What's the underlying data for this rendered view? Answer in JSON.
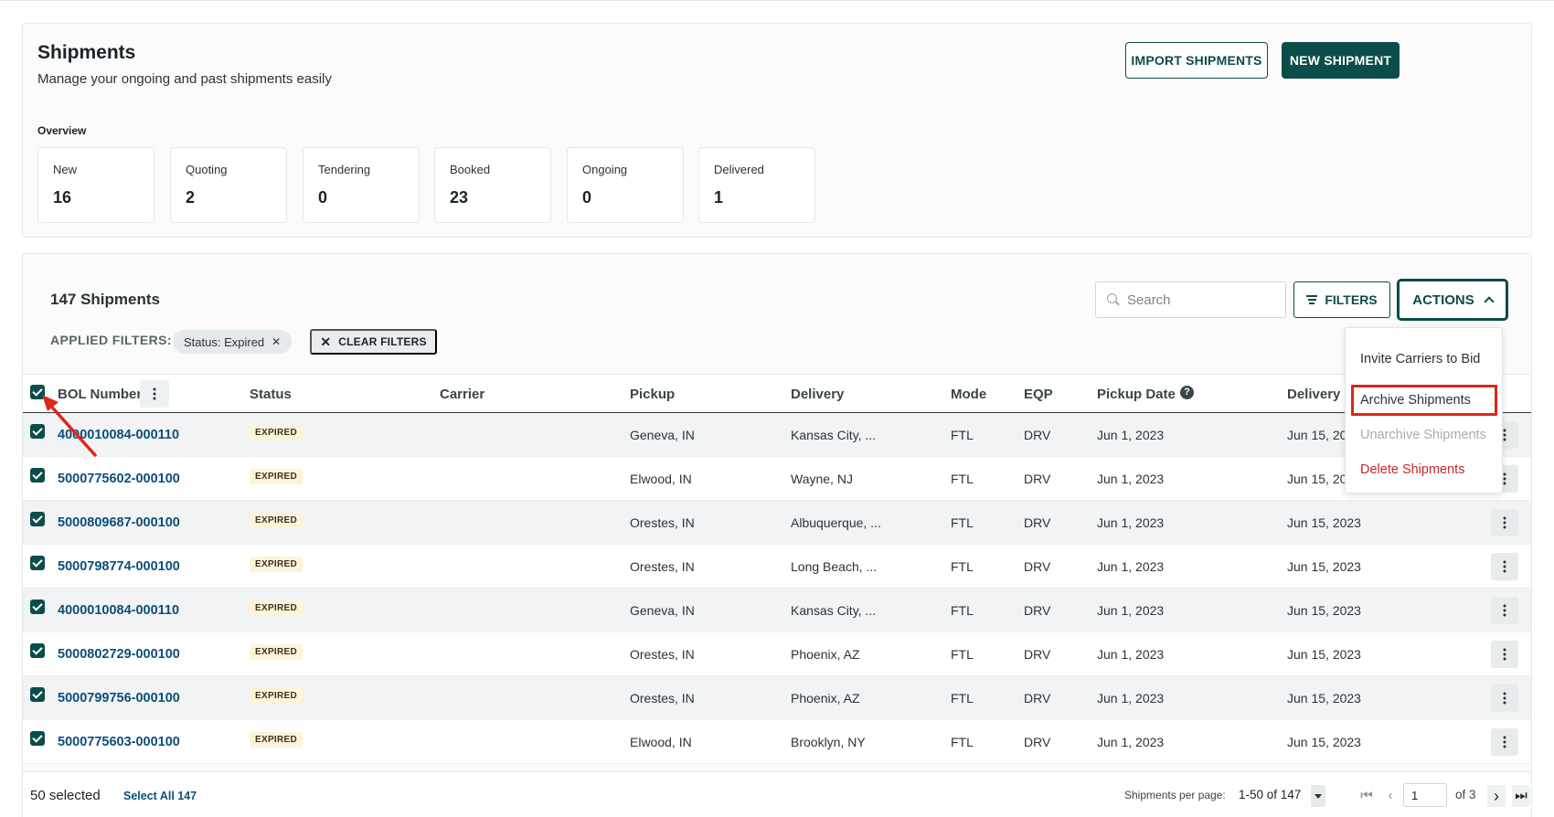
{
  "header": {
    "title": "Shipments",
    "subtitle": "Manage your ongoing and past shipments easily",
    "import_label": "IMPORT SHIPMENTS",
    "new_label": "NEW SHIPMENT"
  },
  "overview": {
    "label": "Overview",
    "stats": [
      {
        "label": "New",
        "value": "16"
      },
      {
        "label": "Quoting",
        "value": "2"
      },
      {
        "label": "Tendering",
        "value": "0"
      },
      {
        "label": "Booked",
        "value": "23"
      },
      {
        "label": "Ongoing",
        "value": "0"
      },
      {
        "label": "Delivered",
        "value": "1"
      }
    ]
  },
  "table_header": {
    "count_title": "147 Shipments",
    "search_placeholder": "Search",
    "filters_label": "FILTERS",
    "actions_label": "ACTIONS",
    "applied_filters_label": "APPLIED FILTERS:",
    "chip_label": "Status: Expired",
    "clear_filters_label": "CLEAR FILTERS"
  },
  "columns": {
    "bol": "BOL Number",
    "status": "Status",
    "carrier": "Carrier",
    "pickup": "Pickup",
    "delivery": "Delivery",
    "mode": "Mode",
    "eqp": "EQP",
    "pickup_date": "Pickup Date",
    "delivery_date": "Delivery D"
  },
  "rows": [
    {
      "bol": "4000010084-000110",
      "status": "EXPIRED",
      "carrier": "",
      "pickup": "Geneva, IN",
      "delivery": "Kansas City, ...",
      "mode": "FTL",
      "eqp": "DRV",
      "pickup_date": "Jun 1, 2023",
      "delivery_date": "Jun 15, 20"
    },
    {
      "bol": "5000775602-000100",
      "status": "EXPIRED",
      "carrier": "",
      "pickup": "Elwood, IN",
      "delivery": "Wayne, NJ",
      "mode": "FTL",
      "eqp": "DRV",
      "pickup_date": "Jun 1, 2023",
      "delivery_date": "Jun 15, 20"
    },
    {
      "bol": "5000809687-000100",
      "status": "EXPIRED",
      "carrier": "",
      "pickup": "Orestes, IN",
      "delivery": "Albuquerque, ...",
      "mode": "FTL",
      "eqp": "DRV",
      "pickup_date": "Jun 1, 2023",
      "delivery_date": "Jun 15, 2023"
    },
    {
      "bol": "5000798774-000100",
      "status": "EXPIRED",
      "carrier": "",
      "pickup": "Orestes, IN",
      "delivery": "Long Beach, ...",
      "mode": "FTL",
      "eqp": "DRV",
      "pickup_date": "Jun 1, 2023",
      "delivery_date": "Jun 15, 2023"
    },
    {
      "bol": "4000010084-000110",
      "status": "EXPIRED",
      "carrier": "",
      "pickup": "Geneva, IN",
      "delivery": "Kansas City, ...",
      "mode": "FTL",
      "eqp": "DRV",
      "pickup_date": "Jun 1, 2023",
      "delivery_date": "Jun 15, 2023"
    },
    {
      "bol": "5000802729-000100",
      "status": "EXPIRED",
      "carrier": "",
      "pickup": "Orestes, IN",
      "delivery": "Phoenix, AZ",
      "mode": "FTL",
      "eqp": "DRV",
      "pickup_date": "Jun 1, 2023",
      "delivery_date": "Jun 15, 2023"
    },
    {
      "bol": "5000799756-000100",
      "status": "EXPIRED",
      "carrier": "",
      "pickup": "Orestes, IN",
      "delivery": "Phoenix, AZ",
      "mode": "FTL",
      "eqp": "DRV",
      "pickup_date": "Jun 1, 2023",
      "delivery_date": "Jun 15, 2023"
    },
    {
      "bol": "5000775603-000100",
      "status": "EXPIRED",
      "carrier": "",
      "pickup": "Elwood, IN",
      "delivery": "Brooklyn, NY",
      "mode": "FTL",
      "eqp": "DRV",
      "pickup_date": "Jun 1, 2023",
      "delivery_date": "Jun 15, 2023"
    }
  ],
  "actions_menu": {
    "items": [
      {
        "label": "Invite Carriers to Bid",
        "state": "normal"
      },
      {
        "label": "Archive Shipments",
        "state": "highlighted"
      },
      {
        "label": "Unarchive Shipments",
        "state": "disabled"
      },
      {
        "label": "Delete Shipments",
        "state": "danger"
      }
    ]
  },
  "footer": {
    "selected_text": "50 selected",
    "select_all_label": "Select All 147",
    "per_page_label": "Shipments per page:",
    "range_text": "1-50 of 147",
    "page_value": "1",
    "of_pages": "of 3"
  },
  "colors": {
    "brand": "#0b4d4b",
    "link": "#0c4f79",
    "danger": "#c62828",
    "highlight_box": "#e0251b",
    "badge_bg": "#fcf3d9"
  }
}
